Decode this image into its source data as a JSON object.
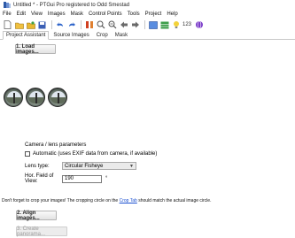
{
  "window": {
    "title": "Untitled * - PTGui Pro registered to Odd Smestad"
  },
  "menu": {
    "items": [
      "File",
      "Edit",
      "View",
      "Images",
      "Mask",
      "Control Points",
      "Tools",
      "Project",
      "Help"
    ]
  },
  "toolbar": {
    "icons": [
      "new-icon",
      "open-icon",
      "folder-icon",
      "save-icon",
      "undo-icon",
      "redo-icon",
      "align-icon",
      "zoom-in-icon",
      "zoom-out-icon",
      "back-icon",
      "forward-icon",
      "panorama-editor-icon",
      "table-icon",
      "light-icon",
      "number-icon",
      "globe-icon"
    ],
    "number_label": "123"
  },
  "tabs": {
    "items": [
      "Project Assistant",
      "Source Images",
      "Crop",
      "Mask"
    ],
    "active": "Project Assistant"
  },
  "steps": {
    "load_label": "1. Load images...",
    "align_label": "2. Align images...",
    "create_label": "3. Create panorama..."
  },
  "thumbnails": {
    "count": 3
  },
  "lens": {
    "group_title": "Camera / lens parameters",
    "auto_label": "Automatic (uses EXIF data from camera, if available)",
    "auto_checked": false,
    "lens_type_label": "Lens type:",
    "lens_type_value": "Circular Fisheye",
    "hfov_label": "Hor. Field of View:",
    "hfov_value": "190",
    "hfov_unit": "°"
  },
  "crop_note": {
    "text_before": "Don't forget to crop your images! The cropping circle on the",
    "link": "Crop Tab",
    "text_after": "should match the actual image circle."
  }
}
